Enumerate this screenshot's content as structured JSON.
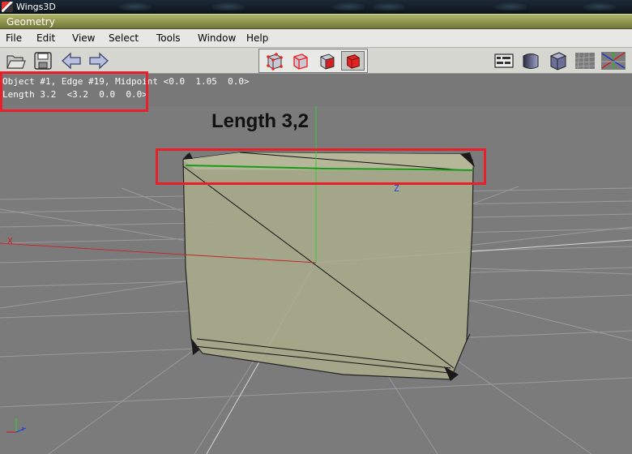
{
  "window": {
    "app_title": "Wings3D",
    "geometry_title": "Geometry"
  },
  "menu": {
    "items": [
      "File",
      "Edit",
      "View",
      "Select",
      "Tools",
      "Window",
      "Help"
    ]
  },
  "toolbar": {
    "left_icons": [
      "open-folder-icon",
      "save-disk-icon",
      "undo-arrow-icon",
      "redo-arrow-icon"
    ],
    "selection_modes": [
      "vertex-mode-icon",
      "edge-mode-icon",
      "face-mode-icon",
      "body-mode-icon"
    ],
    "selected_mode": "body-mode-icon",
    "right_icons": [
      "workmode-icon",
      "smooth-shade-icon",
      "flat-shade-icon",
      "wireframe-icon",
      "axes-grid-icon"
    ]
  },
  "info": {
    "line1": "Object #1, Edge #19, Midpoint <0.0  1.05  0.0>",
    "line2": "Length 3.2  <3.2  0.0  0.0>"
  },
  "annotation": {
    "length_text": "Length 3,2"
  },
  "axes": {
    "x_label": "X",
    "z_label": "Z",
    "x_color": "#c0262c",
    "y_color": "#37c937",
    "z_color": "#2a3bd8"
  },
  "colors": {
    "highlight": "#e8202a",
    "selected_edge": "#1a9a1a",
    "cube_face": "#a7a98a"
  }
}
